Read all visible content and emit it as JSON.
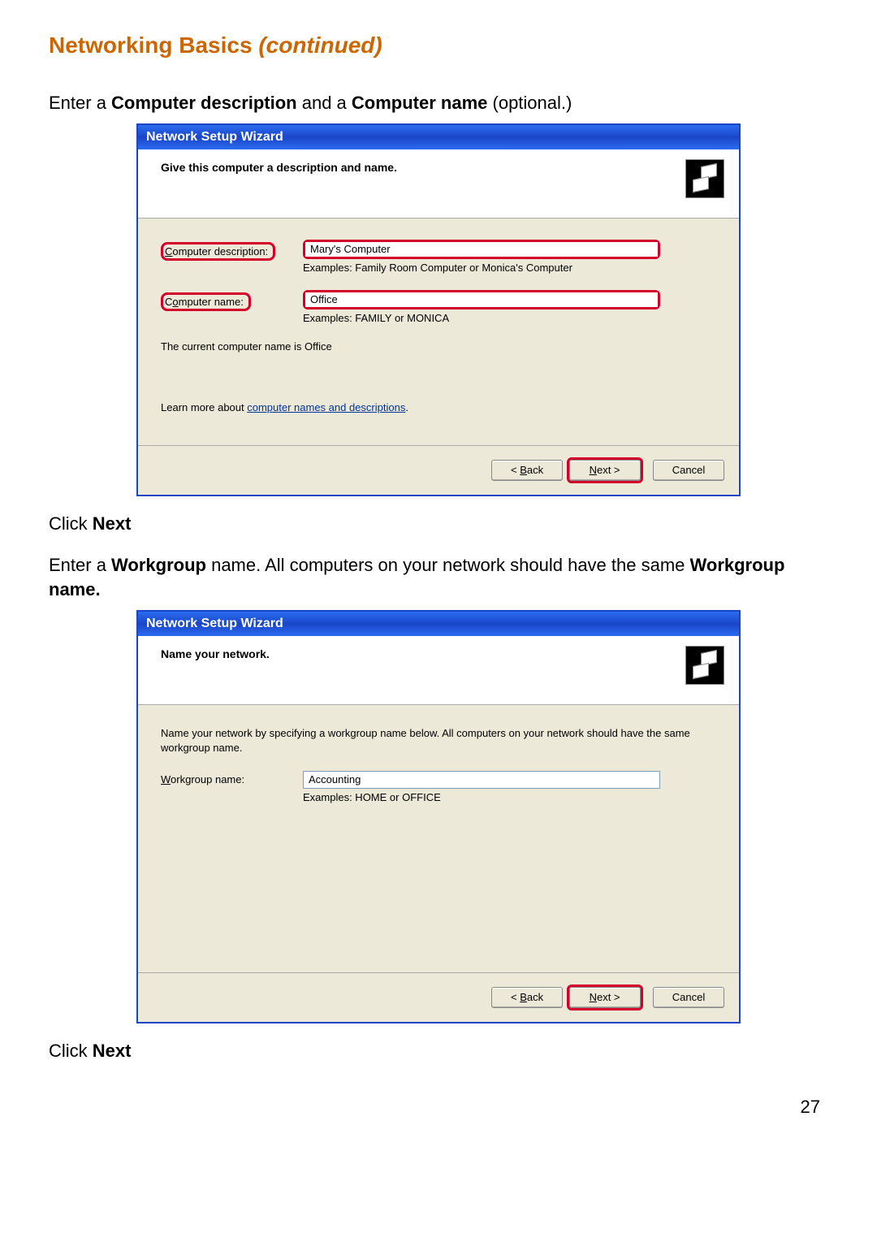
{
  "page": {
    "heading_main": "Networking Basics ",
    "heading_italic": "(continued)",
    "page_number": "27"
  },
  "instr1_a": "Enter a ",
  "instr1_b": "Computer description",
  "instr1_c": " and a ",
  "instr1_d": "Computer name",
  "instr1_e": " (optional.)",
  "wizard1": {
    "title": "Network Setup Wizard",
    "header": "Give this computer a description and name.",
    "desc_label_pre": "C",
    "desc_label": "omputer description:",
    "desc_value": "Mary's Computer",
    "desc_example": "Examples: Family Room Computer or Monica's Computer",
    "name_label_pre": "C",
    "name_label_mid": "o",
    "name_label_post": "mputer name:",
    "name_value": "Office",
    "name_example": "Examples: FAMILY or MONICA",
    "current_name": "The current computer name is Office",
    "learn_pre": "Learn more about ",
    "learn_link": "computer names and descriptions",
    "learn_post": ".",
    "back_pre": "< ",
    "back_u": "B",
    "back_post": "ack",
    "next_u": "N",
    "next_post": "ext >",
    "cancel": "Cancel"
  },
  "click_next_a": "Click ",
  "click_next_b": "Next",
  "instr2_a": "Enter a ",
  "instr2_b": "Workgroup",
  "instr2_c": " name.  All computers on your network should have the same ",
  "instr2_d": "Workgroup name.",
  "wizard2": {
    "title": "Network Setup Wizard",
    "header": "Name your network.",
    "description": "Name your network by specifying a workgroup name below. All computers on your network should have the same workgroup name.",
    "wg_label_u": "W",
    "wg_label_post": "orkgroup name:",
    "wg_value": "Accounting",
    "wg_example": "Examples: HOME or OFFICE",
    "back_pre": "< ",
    "back_u": "B",
    "back_post": "ack",
    "next_u": "N",
    "next_post": "ext >",
    "cancel": "Cancel"
  }
}
